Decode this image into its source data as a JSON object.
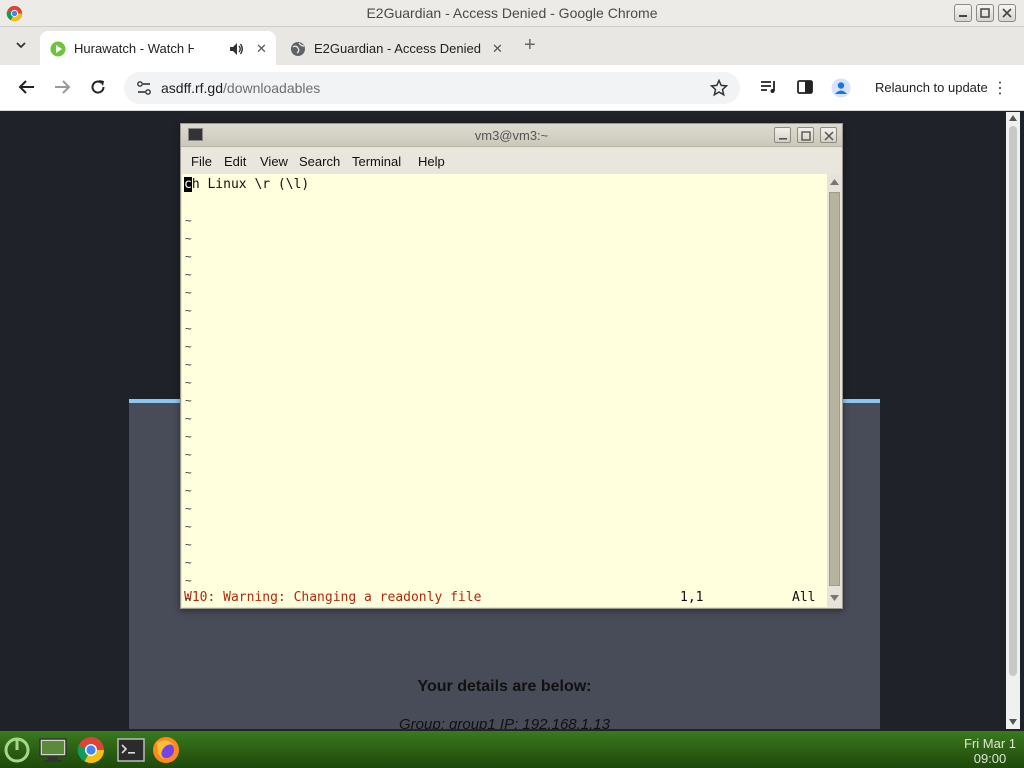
{
  "window": {
    "title": "E2Guardian - Access Denied - Google Chrome"
  },
  "tabs": [
    {
      "label": "Hurawatch - Watch Hazbi",
      "active": true
    },
    {
      "label": "E2Guardian - Access Denied",
      "active": false
    }
  ],
  "toolbar": {
    "url_host": "asdff.rf.gd",
    "url_path": "/downloadables",
    "relaunch_label": "Relaunch to update"
  },
  "page": {
    "details_heading": "Your details are below:",
    "group_line": "Group: group1   IP: 192.168.1.13"
  },
  "terminal": {
    "title": "vm3@vm3:~",
    "menu": [
      "File",
      "Edit",
      "View",
      "Search",
      "Terminal",
      "Help"
    ],
    "cursor_char": "c",
    "line1_rest": "h Linux \\r (\\l)",
    "tilde": "~",
    "status_message": "W10: Warning: Changing a readonly file",
    "status_position": "1,1",
    "status_scroll": "All"
  },
  "taskbar": {
    "clock_day": "Fri Mar 1",
    "clock_time": "09:00"
  },
  "colors": {
    "terminal_bg": "#ffffde",
    "warning_text": "#b02a10",
    "card_border": "#8cc7ef",
    "taskbar": "#2a5b12"
  }
}
